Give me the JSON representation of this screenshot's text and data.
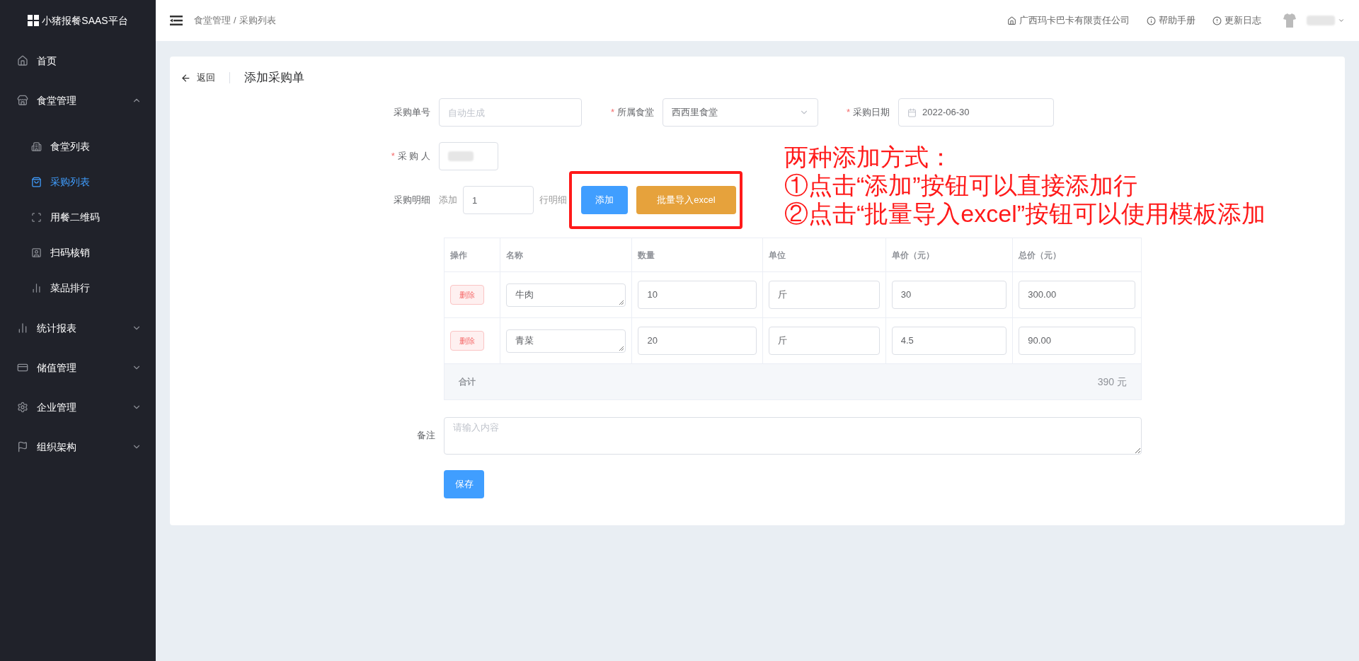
{
  "sidebar": {
    "logo": "小猪报餐SAAS平台",
    "items": [
      {
        "label": "首页",
        "kind": "link"
      },
      {
        "label": "食堂管理",
        "kind": "group",
        "expanded": true,
        "children": [
          {
            "label": "食堂列表",
            "selected": false
          },
          {
            "label": "采购列表",
            "selected": true
          },
          {
            "label": "用餐二维码",
            "selected": false
          },
          {
            "label": "扫码核销",
            "selected": false
          },
          {
            "label": "菜品排行",
            "selected": false
          }
        ]
      },
      {
        "label": "统计报表",
        "kind": "group",
        "expanded": false
      },
      {
        "label": "储值管理",
        "kind": "group",
        "expanded": false
      },
      {
        "label": "企业管理",
        "kind": "group",
        "expanded": false
      },
      {
        "label": "组织架构",
        "kind": "group",
        "expanded": false
      }
    ]
  },
  "header": {
    "breadcrumb": [
      "食堂管理",
      "采购列表"
    ],
    "separator": "/",
    "links": [
      "广西玛卡巴卡有限责任公司",
      "帮助手册",
      "更新日志"
    ]
  },
  "page": {
    "back": "返回",
    "title": "添加采购单"
  },
  "form": {
    "required_mark": "*",
    "order_no": {
      "label": "采购单号",
      "placeholder": "自动生成"
    },
    "canteen": {
      "label": "所属食堂",
      "value": "西西里食堂",
      "required": true
    },
    "date": {
      "label": "采购日期",
      "value": "2022-06-30",
      "required": true
    },
    "buyer": {
      "label": "采 购 人",
      "required": true
    },
    "detail": {
      "label": "采购明细",
      "prefix": "添加",
      "count": "1",
      "suffix": "行明细",
      "add_button": "添加",
      "import_button": "批量导入excel"
    },
    "table": {
      "columns": [
        "操作",
        "名称",
        "数量",
        "单位",
        "单价（元）",
        "总价（元）"
      ],
      "rows": [
        {
          "action": "删除",
          "name": "牛肉",
          "quantity": "10",
          "unit": "斤",
          "price": "30",
          "total": "300.00"
        },
        {
          "action": "删除",
          "name": "青菜",
          "quantity": "20",
          "unit": "斤",
          "price": "4.5",
          "total": "90.00"
        }
      ],
      "footer_label": "合计",
      "footer_value": "390 元"
    },
    "remark": {
      "label": "备注",
      "placeholder": "请输入内容"
    },
    "save": "保存"
  },
  "annotation": [
    "两种添加方式：",
    "①点击“添加”按钮可以直接添加行",
    "②点击“批量导入excel”按钮可以使用模板添加"
  ]
}
